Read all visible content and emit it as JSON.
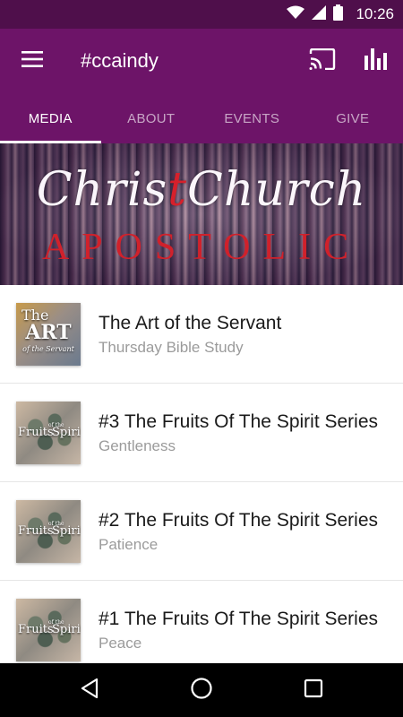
{
  "status_bar": {
    "time": "10:26"
  },
  "app_bar": {
    "title": "#ccaindy"
  },
  "tabs": [
    {
      "label": "MEDIA",
      "active": true
    },
    {
      "label": "ABOUT",
      "active": false
    },
    {
      "label": "EVENTS",
      "active": false
    },
    {
      "label": "GIVE",
      "active": false
    }
  ],
  "banner": {
    "script_part1": "Chris",
    "script_cross": "t",
    "script_part2": "Church",
    "subtitle": "APOSTOLIC"
  },
  "media_items": [
    {
      "title": "The Art of the Servant",
      "subtitle": "Thursday Bible Study",
      "thumb_line1": "The",
      "thumb_line2": "ART",
      "thumb_line3": "of the Servant"
    },
    {
      "title": "#3 The Fruits Of The Spirit  Series",
      "subtitle": "Gentleness",
      "thumb_line1": "Fruits",
      "thumb_line2": "of the",
      "thumb_line3": "Spirit"
    },
    {
      "title": "#2 The Fruits Of The Spirit  Series",
      "subtitle": "Patience",
      "thumb_line1": "Fruits",
      "thumb_line2": "of the",
      "thumb_line3": "Spirit"
    },
    {
      "title": "#1 The Fruits Of The Spirit  Series",
      "subtitle": "Peace",
      "thumb_line1": "Fruits",
      "thumb_line2": "of the",
      "thumb_line3": "Spirit"
    }
  ],
  "colors": {
    "status_bar": "#4f0f4b",
    "app_bar": "#6d1468",
    "accent_red": "#d0212b"
  },
  "icons": {
    "wifi": "wifi-icon",
    "signal": "signal-icon",
    "battery": "battery-icon",
    "menu": "menu-icon",
    "cast": "cast-icon",
    "chart": "bar-chart-icon",
    "back": "back-icon",
    "home": "home-icon",
    "recents": "recents-icon"
  }
}
